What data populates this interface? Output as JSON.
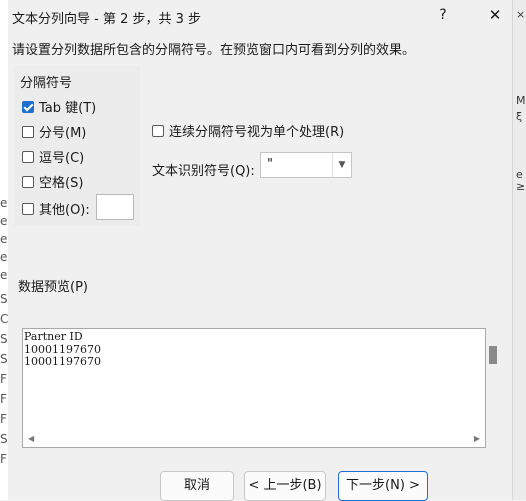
{
  "background": {
    "right_marks": [
      "×",
      "M",
      "ξ",
      "e",
      "≥"
    ],
    "left_marks": [
      "e",
      "e",
      "e",
      "e",
      "e",
      "S",
      "C",
      "S",
      "S",
      "F",
      "F",
      "F",
      "S",
      "F"
    ]
  },
  "dialog": {
    "title": "文本分列向导 - 第 2 步，共 3 步",
    "help_label": "?",
    "close_label": "✕",
    "instruction": "请设置分列数据所包含的分隔符号。在预览窗口内可看到分列的效果。"
  },
  "delimiters": {
    "group_label": "分隔符号",
    "options": [
      {
        "label": "Tab 键(T)",
        "checked": true
      },
      {
        "label": "分号(M)",
        "checked": false
      },
      {
        "label": "逗号(C)",
        "checked": false
      },
      {
        "label": "空格(S)",
        "checked": false
      },
      {
        "label": "其他(O):",
        "checked": false
      }
    ],
    "other_value": ""
  },
  "consecutive": {
    "label": "连续分隔符号视为单个处理(R)",
    "checked": false
  },
  "text_qualifier": {
    "label": "文本识别符号(Q):",
    "value": "\""
  },
  "preview": {
    "label": "数据预览(P)",
    "lines": [
      "Partner ID",
      "",
      "",
      "",
      "",
      "10001197670",
      "10001197670"
    ]
  },
  "buttons": {
    "cancel": "取消",
    "back": "< 上一步(B)",
    "next": "下一步(N) >"
  },
  "colors": {
    "accent": "#1f6fd0",
    "dialog_bg": "#f0f0f0"
  }
}
